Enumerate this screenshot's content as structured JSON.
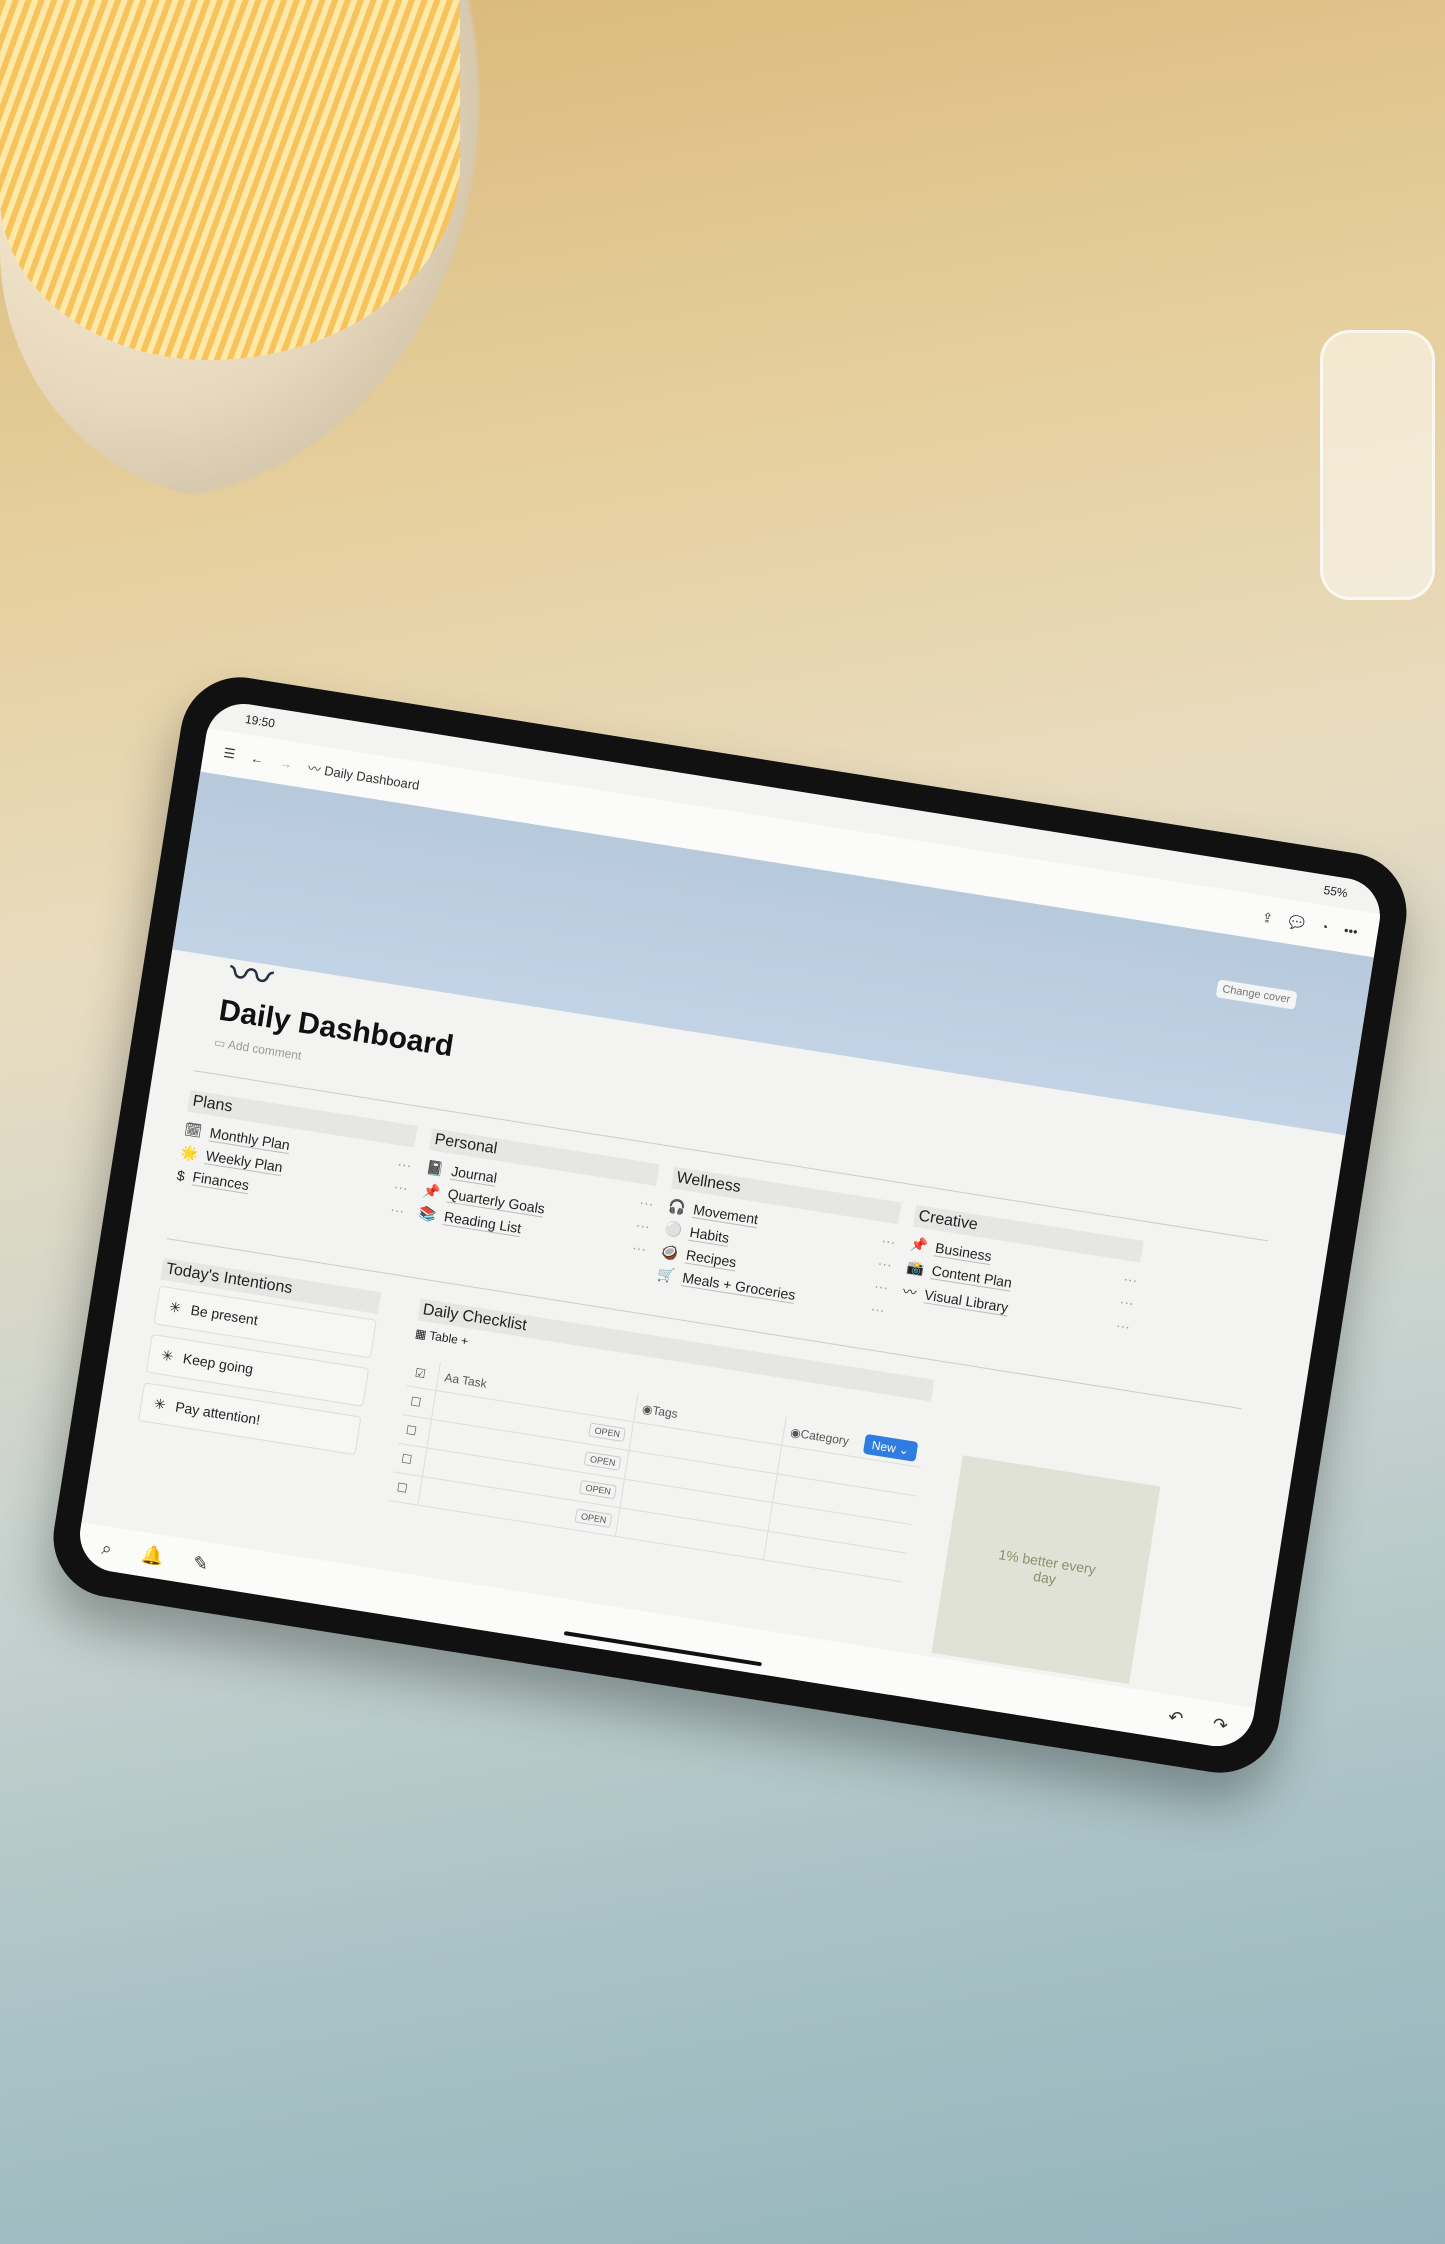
{
  "status": {
    "time": "19:50",
    "battery": "55%"
  },
  "topbar": {
    "title": "Daily Dashboard",
    "menu_icon": "hamburger-icon",
    "back_icon": "arrow-left-icon",
    "forward_icon": "arrow-right-icon",
    "more_dots": "•••"
  },
  "cover": {
    "change_cover": "Change cover",
    "color": "#b7c9dc"
  },
  "page": {
    "icon": "〰",
    "title": "Daily Dashboard",
    "add_comment": "Add comment"
  },
  "sections": [
    {
      "title": "Plans",
      "items": [
        {
          "icon": "🗓",
          "label": "Monthly Plan"
        },
        {
          "icon": "🌟",
          "label": "Weekly Plan"
        },
        {
          "icon": "$",
          "label": "Finances"
        }
      ]
    },
    {
      "title": "Personal",
      "items": [
        {
          "icon": "📓",
          "label": "Journal"
        },
        {
          "icon": "📌",
          "label": "Quarterly Goals"
        },
        {
          "icon": "📚",
          "label": "Reading List"
        }
      ]
    },
    {
      "title": "Wellness",
      "items": [
        {
          "icon": "🎧",
          "label": "Movement"
        },
        {
          "icon": "⚪",
          "label": "Habits"
        },
        {
          "icon": "🥥",
          "label": "Recipes"
        },
        {
          "icon": "🛒",
          "label": "Meals + Groceries"
        }
      ]
    },
    {
      "title": "Creative",
      "items": [
        {
          "icon": "📌",
          "label": "Business"
        },
        {
          "icon": "📸",
          "label": "Content Plan"
        },
        {
          "icon": "〰",
          "label": "Visual Library"
        }
      ]
    }
  ],
  "intentions": {
    "title": "Today's Intentions",
    "items": [
      "Be present",
      "Keep going",
      "Pay attention!"
    ]
  },
  "checklist": {
    "title": "Daily Checklist",
    "view": "Table",
    "add": "+",
    "columns": [
      "Aa Task",
      "Tags",
      "Category"
    ],
    "new_label": "New",
    "open_label": "OPEN",
    "rows": 4
  },
  "quote": {
    "text": "1% better every day",
    "accent": "#2f7de1"
  }
}
